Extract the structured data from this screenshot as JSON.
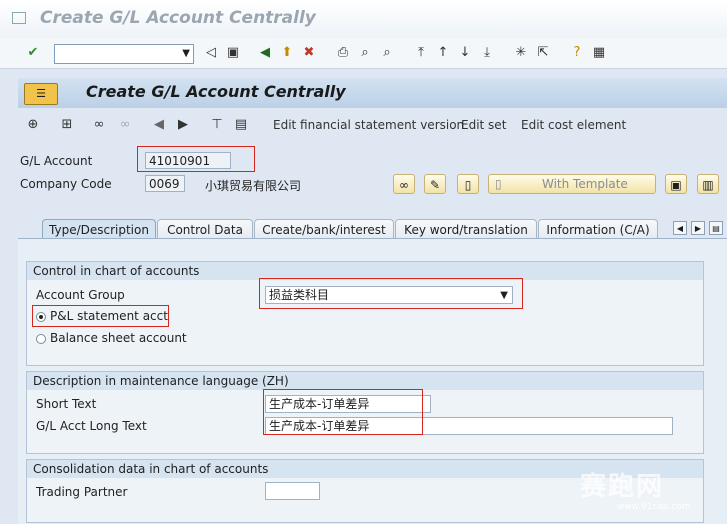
{
  "window": {
    "title": "Create G/L Account Centrally"
  },
  "toolbar1": {
    "command_value": ""
  },
  "header": {
    "title": "Create G/L Account Centrally"
  },
  "toolbar2": {
    "links": [
      "Edit financial statement version",
      "Edit set",
      "Edit cost element"
    ]
  },
  "fields": {
    "gl_account": {
      "label": "G/L Account",
      "value": "41010901"
    },
    "company_code": {
      "label": "Company Code",
      "value": "0069",
      "name": "小琪贸易有限公司"
    },
    "template_button": "With Template"
  },
  "tabs": [
    {
      "label": "Type/Description",
      "active": true
    },
    {
      "label": "Control Data",
      "active": false
    },
    {
      "label": "Create/bank/interest",
      "active": false
    },
    {
      "label": "Key word/translation",
      "active": false
    },
    {
      "label": "Information (C/A)",
      "active": false
    }
  ],
  "control_group": {
    "title": "Control in chart of accounts",
    "account_group_label": "Account Group",
    "account_group_value": "损益类科目",
    "radio_pl": "P&L statement acct",
    "radio_bs": "Balance sheet account"
  },
  "description_group": {
    "title": "Description in maintenance language (ZH)",
    "short_text_label": "Short Text",
    "short_text_value": "生产成本-订单差异",
    "long_text_label": "G/L Acct Long Text",
    "long_text_value": "生产成本-订单差异"
  },
  "consolidation_group": {
    "title": "Consolidation data in chart of accounts",
    "trading_partner_label": "Trading Partner",
    "trading_partner_value": ""
  },
  "watermark": {
    "text": "赛跑网",
    "url": "www.91sap.com"
  }
}
